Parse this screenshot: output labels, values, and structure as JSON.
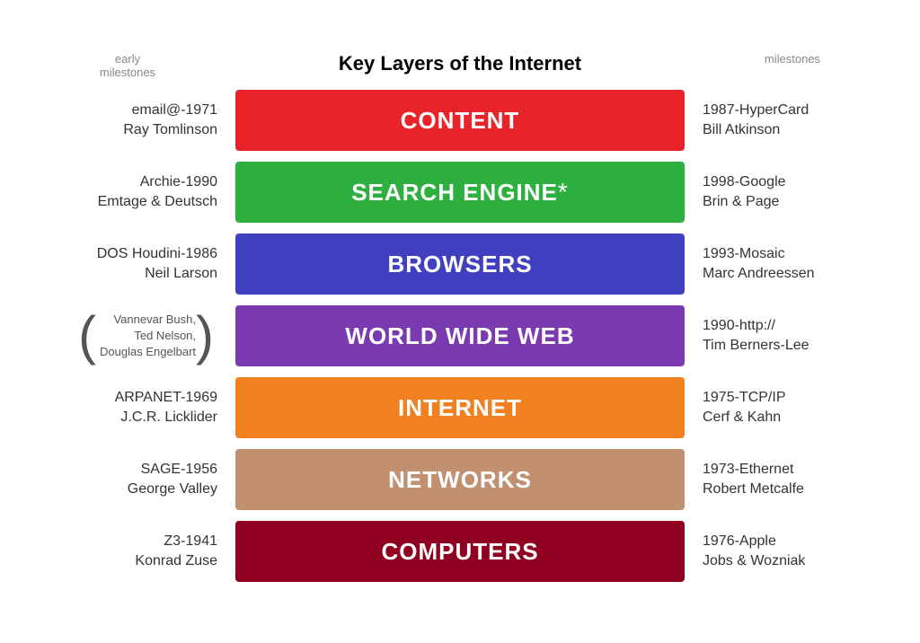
{
  "header": {
    "left_label": "early\nmilestones",
    "title": "Key Layers of the Internet",
    "right_label": "milestones"
  },
  "layers": [
    {
      "id": "content",
      "bar_label": "CONTENT",
      "bar_color_class": "color-content",
      "left_line1": "email@-1971",
      "left_line2": "Ray Tomlinson",
      "right_line1": "1987-HyperCard",
      "right_line2": "Bill Atkinson",
      "use_bracket": false,
      "has_asterisk": false
    },
    {
      "id": "search-engine",
      "bar_label": "SEARCH ENGINE",
      "bar_color_class": "color-search",
      "left_line1": "Archie-1990",
      "left_line2": "Emtage & Deutsch",
      "right_line1": "1998-Google",
      "right_line2": "Brin & Page",
      "use_bracket": false,
      "has_asterisk": true
    },
    {
      "id": "browsers",
      "bar_label": "BROWSERS",
      "bar_color_class": "color-browsers",
      "left_line1": "DOS Houdini-1986",
      "left_line2": "Neil Larson",
      "right_line1": "1993-Mosaic",
      "right_line2": "Marc Andreessen",
      "use_bracket": false,
      "has_asterisk": false
    },
    {
      "id": "www",
      "bar_label": "WORLD WIDE WEB",
      "bar_color_class": "color-www",
      "bracket_lines": [
        "Vannevar Bush,",
        "Ted Nelson,",
        "Douglas Engelbart"
      ],
      "right_line1": "1990-http://",
      "right_line2": "Tim Berners-Lee",
      "use_bracket": true,
      "has_asterisk": false
    },
    {
      "id": "internet",
      "bar_label": "INTERNET",
      "bar_color_class": "color-internet",
      "left_line1": "ARPANET-1969",
      "left_line2": "J.C.R. Licklider",
      "right_line1": "1975-TCP/IP",
      "right_line2": "Cerf & Kahn",
      "use_bracket": false,
      "has_asterisk": false
    },
    {
      "id": "networks",
      "bar_label": "NETWORKS",
      "bar_color_class": "color-networks",
      "left_line1": "SAGE-1956",
      "left_line2": "George Valley",
      "right_line1": "1973-Ethernet",
      "right_line2": "Robert Metcalfe",
      "use_bracket": false,
      "has_asterisk": false
    },
    {
      "id": "computers",
      "bar_label": "COMPUTERS",
      "bar_color_class": "color-computers",
      "left_line1": "Z3-1941",
      "left_line2": "Konrad Zuse",
      "right_line1": "1976-Apple",
      "right_line2": "Jobs & Wozniak",
      "use_bracket": false,
      "has_asterisk": false
    }
  ]
}
